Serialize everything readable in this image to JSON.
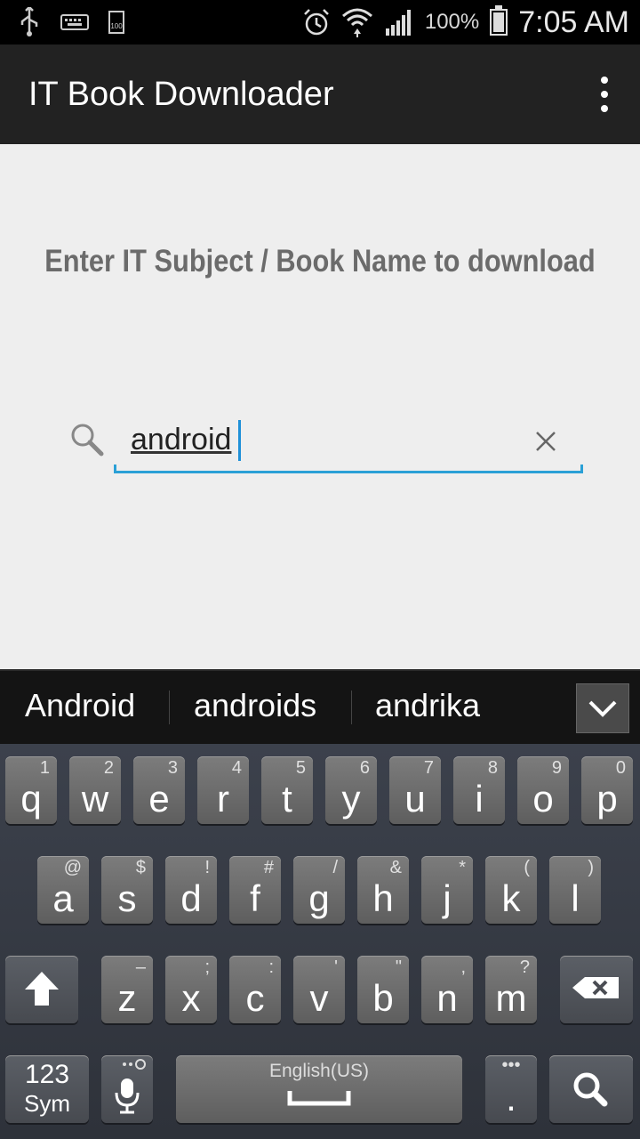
{
  "status": {
    "battery_percent": "100%",
    "time": "7:05 AM",
    "small_battery": "100"
  },
  "app": {
    "title": "IT Book Downloader"
  },
  "main": {
    "prompt": "Enter IT Subject / Book Name to download",
    "search_value": "android"
  },
  "suggestions": [
    "Android",
    "androids",
    "andrika"
  ],
  "keyboard": {
    "row1": [
      {
        "key": "q",
        "alt": "1"
      },
      {
        "key": "w",
        "alt": "2"
      },
      {
        "key": "e",
        "alt": "3"
      },
      {
        "key": "r",
        "alt": "4"
      },
      {
        "key": "t",
        "alt": "5"
      },
      {
        "key": "y",
        "alt": "6"
      },
      {
        "key": "u",
        "alt": "7"
      },
      {
        "key": "i",
        "alt": "8"
      },
      {
        "key": "o",
        "alt": "9"
      },
      {
        "key": "p",
        "alt": "0"
      }
    ],
    "row2": [
      {
        "key": "a",
        "alt": "@"
      },
      {
        "key": "s",
        "alt": "$"
      },
      {
        "key": "d",
        "alt": "!"
      },
      {
        "key": "f",
        "alt": "#"
      },
      {
        "key": "g",
        "alt": "/"
      },
      {
        "key": "h",
        "alt": "&"
      },
      {
        "key": "j",
        "alt": "*"
      },
      {
        "key": "k",
        "alt": "("
      },
      {
        "key": "l",
        "alt": ")"
      }
    ],
    "row3": [
      {
        "key": "z",
        "alt": "–"
      },
      {
        "key": "x",
        "alt": ";"
      },
      {
        "key": "c",
        "alt": ":"
      },
      {
        "key": "v",
        "alt": "'"
      },
      {
        "key": "b",
        "alt": "\""
      },
      {
        "key": "n",
        "alt": ","
      },
      {
        "key": "m",
        "alt": "?"
      }
    ],
    "sym_top": "123",
    "sym_bottom": "Sym",
    "space_label": "English(US)",
    "period": "."
  },
  "colors": {
    "accent": "#2aa0d6",
    "actionbar": "#222222",
    "content_bg": "#eeeeee"
  },
  "icons": [
    "usb-icon",
    "keyboard-icon",
    "battery-small-icon",
    "alarm-icon",
    "wifi-icon",
    "signal-icon",
    "battery-icon",
    "overflow-menu-icon",
    "search-icon",
    "clear-icon",
    "chevron-down-icon",
    "shift-icon",
    "backspace-icon",
    "microphone-icon",
    "settings-icon",
    "space-icon",
    "search-key-icon"
  ]
}
